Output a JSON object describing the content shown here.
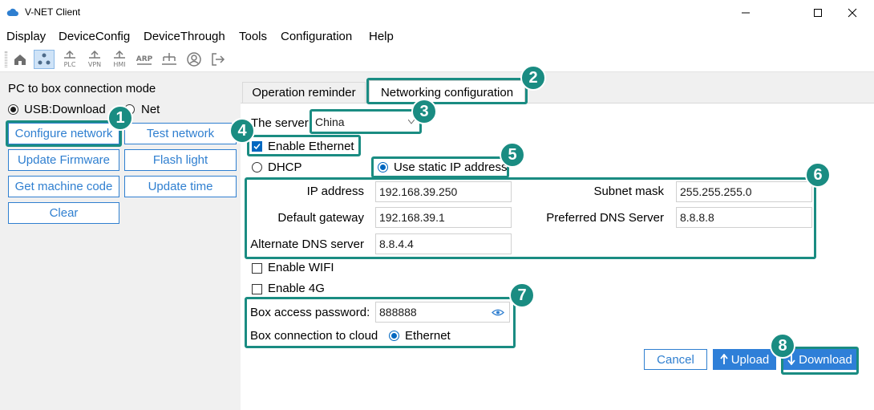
{
  "window": {
    "title": "V-NET Client"
  },
  "menu": [
    "Display",
    "DeviceConfig",
    "DeviceThrough",
    "Tools",
    "Configuration",
    "Help"
  ],
  "toolbar": {
    "plc_label": "PLC",
    "vpn_label": "VPN",
    "hmi_label": "HMI",
    "arp_label": "ARP"
  },
  "left": {
    "title": "PC to box connection mode",
    "mode_usb": "USB:Download",
    "mode_net": "Net",
    "buttons": {
      "configure_network": "Configure network",
      "test_network": "Test network",
      "update_firmware": "Update Firmware",
      "flash_light": "Flash light",
      "get_machine_code": "Get machine code",
      "update_time": "Update time",
      "clear": "Clear"
    }
  },
  "tabs": {
    "operation_reminder": "Operation reminder",
    "networking_configuration": "Networking configuration"
  },
  "config": {
    "server_label": "The server:",
    "server_value": "China",
    "enable_ethernet": "Enable Ethernet",
    "dhcp": "DHCP",
    "static_ip": "Use static IP address",
    "ip_label": "IP address",
    "ip_value": "192.168.39.250",
    "subnet_label": "Subnet mask",
    "subnet_value": "255.255.255.0",
    "gateway_label": "Default gateway",
    "gateway_value": "192.168.39.1",
    "dns_pref_label": "Preferred DNS Server",
    "dns_pref_value": "8.8.8.8",
    "dns_alt_label": "Alternate DNS server",
    "dns_alt_value": "8.8.4.4",
    "enable_wifi": "Enable WIFI",
    "enable_4g": "Enable 4G",
    "password_label": "Box access password:",
    "password_value": "888888",
    "cloud_label": "Box connection to cloud",
    "cloud_value": "Ethernet"
  },
  "actions": {
    "cancel": "Cancel",
    "upload": "Upload",
    "download": "Download"
  },
  "annotations": [
    "1",
    "2",
    "3",
    "4",
    "5",
    "6",
    "7",
    "8"
  ],
  "colors": {
    "accent": "#2e7fd8",
    "highlight": "#1a8c82"
  }
}
